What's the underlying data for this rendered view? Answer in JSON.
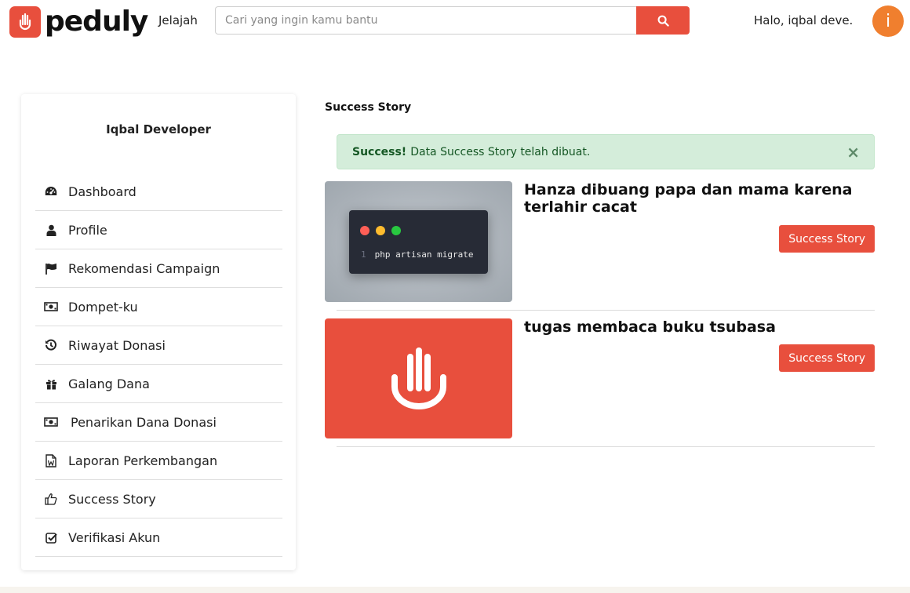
{
  "header": {
    "logo_text": "peduly",
    "nav_explore": "Jelajah",
    "search_placeholder": "Cari yang ingin kamu bantu",
    "greeting": "Halo, iqbal deve...",
    "avatar_initial": "i",
    "brand_color": "#e84f3d",
    "avatar_color": "#f07f2e"
  },
  "sidebar": {
    "user_name": "Iqbal Developer",
    "items": [
      {
        "label": "Dashboard",
        "icon": "tachometer-icon"
      },
      {
        "label": "Profile",
        "icon": "user-icon"
      },
      {
        "label": "Rekomendasi Campaign",
        "icon": "flag-icon"
      },
      {
        "label": "Dompet-ku",
        "icon": "money-icon"
      },
      {
        "label": "Riwayat Donasi",
        "icon": "history-icon"
      },
      {
        "label": "Galang Dana",
        "icon": "gift-icon"
      },
      {
        "label": "Penarikan Dana Donasi",
        "icon": "money-icon"
      },
      {
        "label": "Laporan Perkembangan",
        "icon": "word-file-icon"
      },
      {
        "label": "Success Story",
        "icon": "thumbs-up-icon"
      },
      {
        "label": "Verifikasi Akun",
        "icon": "check-square-icon"
      }
    ]
  },
  "main": {
    "title": "Success Story",
    "alert": {
      "strong": "Success!",
      "message": "Data Success Story telah dibuat.",
      "close": "×"
    },
    "stories": [
      {
        "title": "Hanza dibuang papa dan mama karena terlahir cacat",
        "button": "Success Story",
        "image": {
          "type": "terminal",
          "line_number": "1",
          "code": "php artisan migrate"
        }
      },
      {
        "title": "tugas membaca buku tsubasa",
        "button": "Success Story",
        "image": {
          "type": "logo",
          "icon": "hand-logo-icon"
        }
      }
    ]
  }
}
